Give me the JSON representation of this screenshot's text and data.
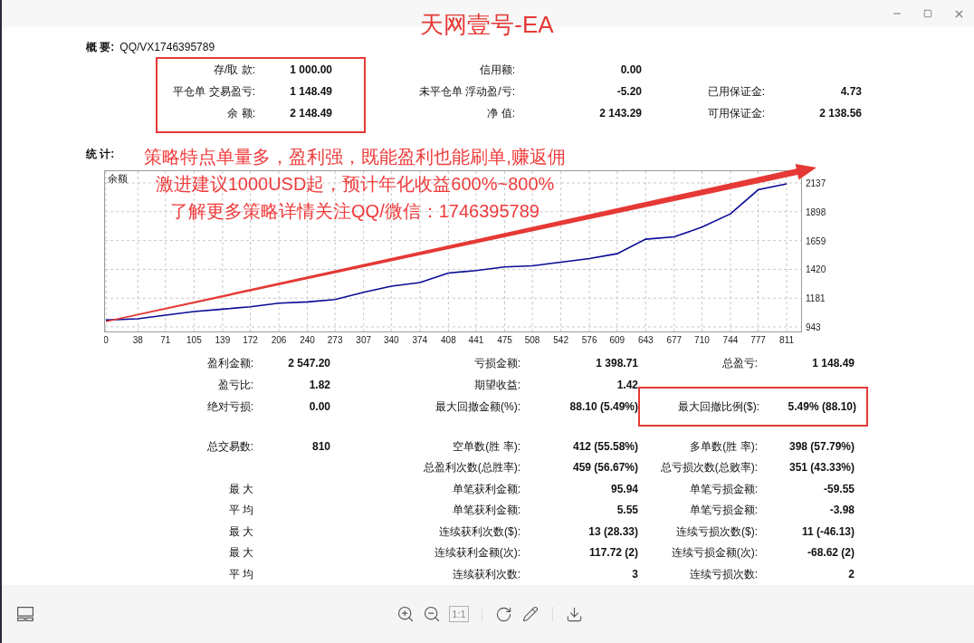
{
  "banner": "天网壹号-EA",
  "summary": {
    "heading": "概 要:",
    "account": "QQ/VX1746395789",
    "columns": [
      {
        "boxed": true,
        "items": [
          {
            "label": "存/取 款:",
            "value": "1 000.00"
          },
          {
            "label": "平仓单 交易盈亏:",
            "value": "1 148.49"
          },
          {
            "label": "余 额:",
            "value": "2 148.49"
          }
        ]
      },
      {
        "boxed": false,
        "items": [
          {
            "label": "信用额:",
            "value": "0.00"
          },
          {
            "label": "未平仓单 浮动盈/亏:",
            "value": "-5.20"
          },
          {
            "label": "净 值:",
            "value": "2 143.29"
          }
        ]
      },
      {
        "boxed": false,
        "first_row_empty": true,
        "items": [
          {
            "label": "已用保证金:",
            "value": "4.73"
          },
          {
            "label": "可用保证金:",
            "value": "2 138.56"
          }
        ]
      }
    ]
  },
  "stats": {
    "heading": "统 计:",
    "chart_data": {
      "type": "line",
      "title": "余额",
      "grid": true,
      "x": [
        0,
        38,
        71,
        105,
        139,
        172,
        206,
        240,
        273,
        307,
        340,
        374,
        408,
        441,
        475,
        508,
        542,
        576,
        609,
        643,
        677,
        710,
        744,
        777,
        811
      ],
      "xlim": [
        0,
        826
      ],
      "ylim": [
        905,
        2242
      ],
      "xticks": [
        0,
        38,
        71,
        105,
        139,
        172,
        206,
        240,
        273,
        307,
        340,
        374,
        408,
        441,
        475,
        508,
        542,
        576,
        609,
        643,
        677,
        710,
        744,
        777,
        811
      ],
      "yticks": [
        943,
        1181,
        1420,
        1659,
        1898,
        2137
      ],
      "series": [
        {
          "color": "#0a0a96",
          "values": [
            1000,
            1010,
            1040,
            1070,
            1090,
            1110,
            1140,
            1150,
            1170,
            1230,
            1280,
            1310,
            1390,
            1410,
            1440,
            1450,
            1480,
            1510,
            1550,
            1670,
            1690,
            1770,
            1880,
            2080,
            2130
          ]
        }
      ]
    },
    "annotations": [
      "策略特点单量多，盈利强，既能盈利也能刷单,赚返佣",
      "激进建议1000USD起，预计年化收益600%~800%",
      "了解更多策略详情关注QQ/微信：1746395789"
    ],
    "groups": [
      [
        {
          "cells": [
            {
              "label": "盈利金额:",
              "value": "2 547.20",
              "boxed": false
            },
            {
              "label": "亏损金额:",
              "value": "1 398.71",
              "boxed": false
            },
            {
              "label": "总盈亏:",
              "value": "1 148.49",
              "boxed": false
            }
          ]
        },
        {
          "cells": [
            {
              "label": "盈亏比:",
              "value": "1.82",
              "boxed": false
            },
            {
              "label": "期望收益:",
              "value": "1.42",
              "boxed": false
            },
            null
          ]
        },
        {
          "cells": [
            {
              "label": "绝对亏损:",
              "value": "0.00",
              "boxed": false
            },
            {
              "label": "最大回撤金额(%):",
              "value": "88.10 (5.49%)",
              "boxed": false
            },
            {
              "label": "最大回撤比例($):",
              "value": "5.49% (88.10)",
              "boxed": true
            }
          ]
        }
      ],
      [
        {
          "cells": [
            {
              "label": "总交易数:",
              "value": "810",
              "boxed": false
            },
            {
              "label": "空单数(胜 率):",
              "value": "412 (55.58%)",
              "boxed": false
            },
            {
              "label": "多单数(胜 率):",
              "value": "398 (57.79%)",
              "boxed": false
            }
          ]
        },
        {
          "cells": [
            null,
            {
              "label": "总盈利次数(总胜率):",
              "value": "459 (56.67%)",
              "boxed": false
            },
            {
              "label": "总亏损次数(总败率):",
              "value": "351 (43.33%)",
              "boxed": false
            }
          ]
        },
        {
          "cells": [
            {
              "label": "最 大",
              "boxed": false
            },
            {
              "label": "单笔获利金额:",
              "value": "95.94",
              "boxed": false
            },
            {
              "label": "单笔亏损金额:",
              "value": "-59.55",
              "boxed": false
            }
          ]
        },
        {
          "cells": [
            {
              "label": "平 均",
              "boxed": false
            },
            {
              "label": "单笔获利金额:",
              "value": "5.55",
              "boxed": false
            },
            {
              "label": "单笔亏损金额:",
              "value": "-3.98",
              "boxed": false
            }
          ]
        },
        {
          "cells": [
            {
              "label": "最 大",
              "boxed": false
            },
            {
              "label": "连续获利次数($):",
              "value": "13 (28.33)",
              "boxed": false
            },
            {
              "label": "连续亏损次数($):",
              "value": "11 (-46.13)",
              "boxed": false
            }
          ]
        },
        {
          "cells": [
            {
              "label": "最 大",
              "boxed": false
            },
            {
              "label": "连续获利金额(次):",
              "value": "117.72 (2)",
              "boxed": false
            },
            {
              "label": "连续亏损金额(次):",
              "value": "-68.62 (2)",
              "boxed": false
            }
          ]
        },
        {
          "cells": [
            {
              "label": "平 均",
              "boxed": false
            },
            {
              "label": "连续获利次数:",
              "value": "3",
              "boxed": false
            },
            {
              "label": "连续亏损次数:",
              "value": "2",
              "boxed": false
            }
          ]
        }
      ]
    ]
  },
  "toolbar": {
    "actual_size": {
      "label": "1:1",
      "disabled": true
    }
  }
}
